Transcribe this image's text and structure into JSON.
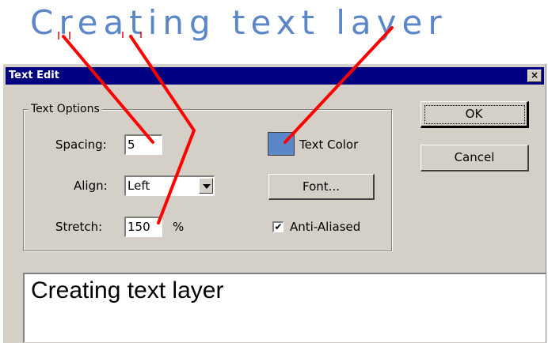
{
  "banner": {
    "text": "Creating text layer"
  },
  "dialog": {
    "title": "Text Edit",
    "close_glyph": "×",
    "group_title": "Text Options",
    "spacing": {
      "label": "Spacing:",
      "value": "5"
    },
    "align": {
      "label": "Align:",
      "value": "Left"
    },
    "stretch": {
      "label": "Stretch:",
      "value": "150",
      "unit": "%"
    },
    "text_color": {
      "label": "Text Color",
      "color": "#5b86c8"
    },
    "font_button": "Font...",
    "anti_aliased": {
      "label": "Anti-Aliased",
      "checked": true,
      "check_glyph": "✔"
    },
    "ok_button": "OK",
    "cancel_button": "Cancel",
    "text_content": "Creating text layer"
  },
  "colors": {
    "banner_text": "#5b86c8",
    "dialog_bg": "#d4d0c8",
    "titlebar": "#000080",
    "annotation_line": "#ff0000"
  },
  "icons": {
    "close": "close-icon",
    "dropdown": "chevron-down-icon",
    "checkbox": "checkmark-icon"
  }
}
